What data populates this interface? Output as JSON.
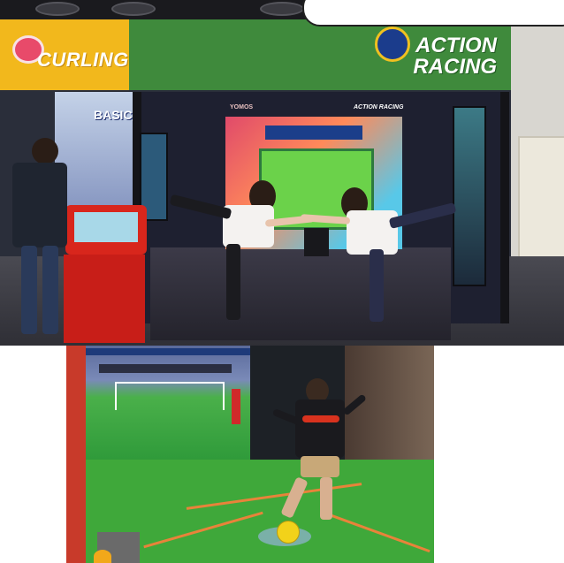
{
  "banner": {
    "text": ""
  },
  "signs": {
    "curling": "CURLING",
    "racing_line1": "ACTION",
    "racing_line2": "RACING"
  },
  "screens": {
    "left_screen_text": "BASIC_B",
    "vendor_logo": "YOMOS",
    "game_logo": "ACTION RACING"
  },
  "icons": {
    "curling_sign": "curling-stone-icon",
    "racing_sign": "racer-badge-icon",
    "soccer_ball": "soccer-ball-icon"
  },
  "colors": {
    "curling_sign": "#f2b81c",
    "racing_sign": "#3f8a3c",
    "kiosk": "#d8261c",
    "turf": "#3fa83a",
    "ball": "#f2d21a"
  }
}
